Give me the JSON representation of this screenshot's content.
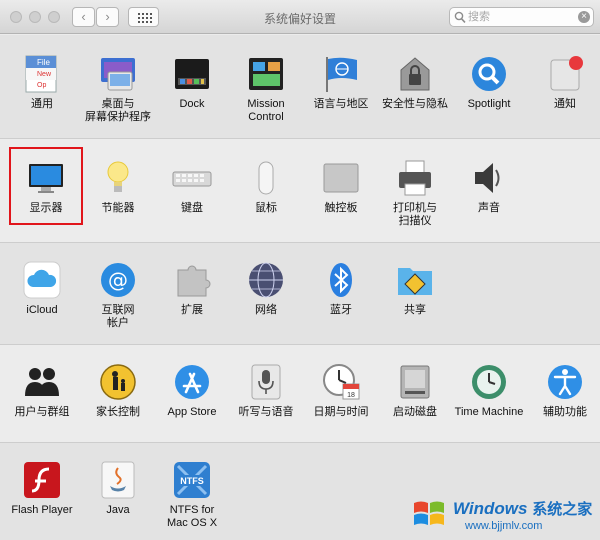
{
  "window": {
    "title": "系统偏好设置"
  },
  "toolbar": {
    "back": "‹",
    "forward": "›"
  },
  "search": {
    "placeholder": "搜索",
    "value": ""
  },
  "rows": {
    "personal": [
      {
        "label": "通用",
        "icon": "general-icon"
      },
      {
        "label": "桌面与\n屏幕保护程序",
        "icon": "desktop-screensaver-icon"
      },
      {
        "label": "Dock",
        "icon": "dock-icon"
      },
      {
        "label": "Mission\nControl",
        "icon": "mission-control-icon"
      },
      {
        "label": "语言与地区",
        "icon": "language-region-icon"
      },
      {
        "label": "安全性与隐私",
        "icon": "security-privacy-icon"
      },
      {
        "label": "Spotlight",
        "icon": "spotlight-icon"
      },
      {
        "label": "通知",
        "icon": "notifications-icon"
      }
    ],
    "hardware": [
      {
        "label": "显示器",
        "icon": "displays-icon"
      },
      {
        "label": "节能器",
        "icon": "energy-saver-icon"
      },
      {
        "label": "键盘",
        "icon": "keyboard-icon"
      },
      {
        "label": "鼠标",
        "icon": "mouse-icon"
      },
      {
        "label": "触控板",
        "icon": "trackpad-icon"
      },
      {
        "label": "打印机与\n扫描仪",
        "icon": "printers-scanners-icon"
      },
      {
        "label": "声音",
        "icon": "sound-icon"
      }
    ],
    "internet": [
      {
        "label": "iCloud",
        "icon": "icloud-icon"
      },
      {
        "label": "互联网\n帐户",
        "icon": "internet-accounts-icon"
      },
      {
        "label": "扩展",
        "icon": "extensions-icon"
      },
      {
        "label": "网络",
        "icon": "network-icon"
      },
      {
        "label": "蓝牙",
        "icon": "bluetooth-icon"
      },
      {
        "label": "共享",
        "icon": "sharing-icon"
      }
    ],
    "system": [
      {
        "label": "用户与群组",
        "icon": "users-groups-icon"
      },
      {
        "label": "家长控制",
        "icon": "parental-controls-icon"
      },
      {
        "label": "App Store",
        "icon": "app-store-icon"
      },
      {
        "label": "听写与语音",
        "icon": "dictation-speech-icon"
      },
      {
        "label": "日期与时间",
        "icon": "date-time-icon"
      },
      {
        "label": "启动磁盘",
        "icon": "startup-disk-icon"
      },
      {
        "label": "Time Machine",
        "icon": "time-machine-icon"
      },
      {
        "label": "辅助功能",
        "icon": "accessibility-icon"
      }
    ],
    "other": [
      {
        "label": "Flash Player",
        "icon": "flash-player-icon"
      },
      {
        "label": "Java",
        "icon": "java-icon"
      },
      {
        "label": "NTFS for\nMac OS X",
        "icon": "ntfs-icon"
      }
    ]
  },
  "icon_text": {
    "general_file": "File",
    "general_new": "New",
    "general_open": "Op",
    "calendar_day": "18",
    "ntfs": "NTFS"
  },
  "watermark": {
    "brand": "Windows",
    "suffix": "系统之家",
    "url": "www.bjjmlv.com"
  },
  "colors": {
    "highlight": "#e1151b",
    "accent": "#1a6fc0"
  }
}
